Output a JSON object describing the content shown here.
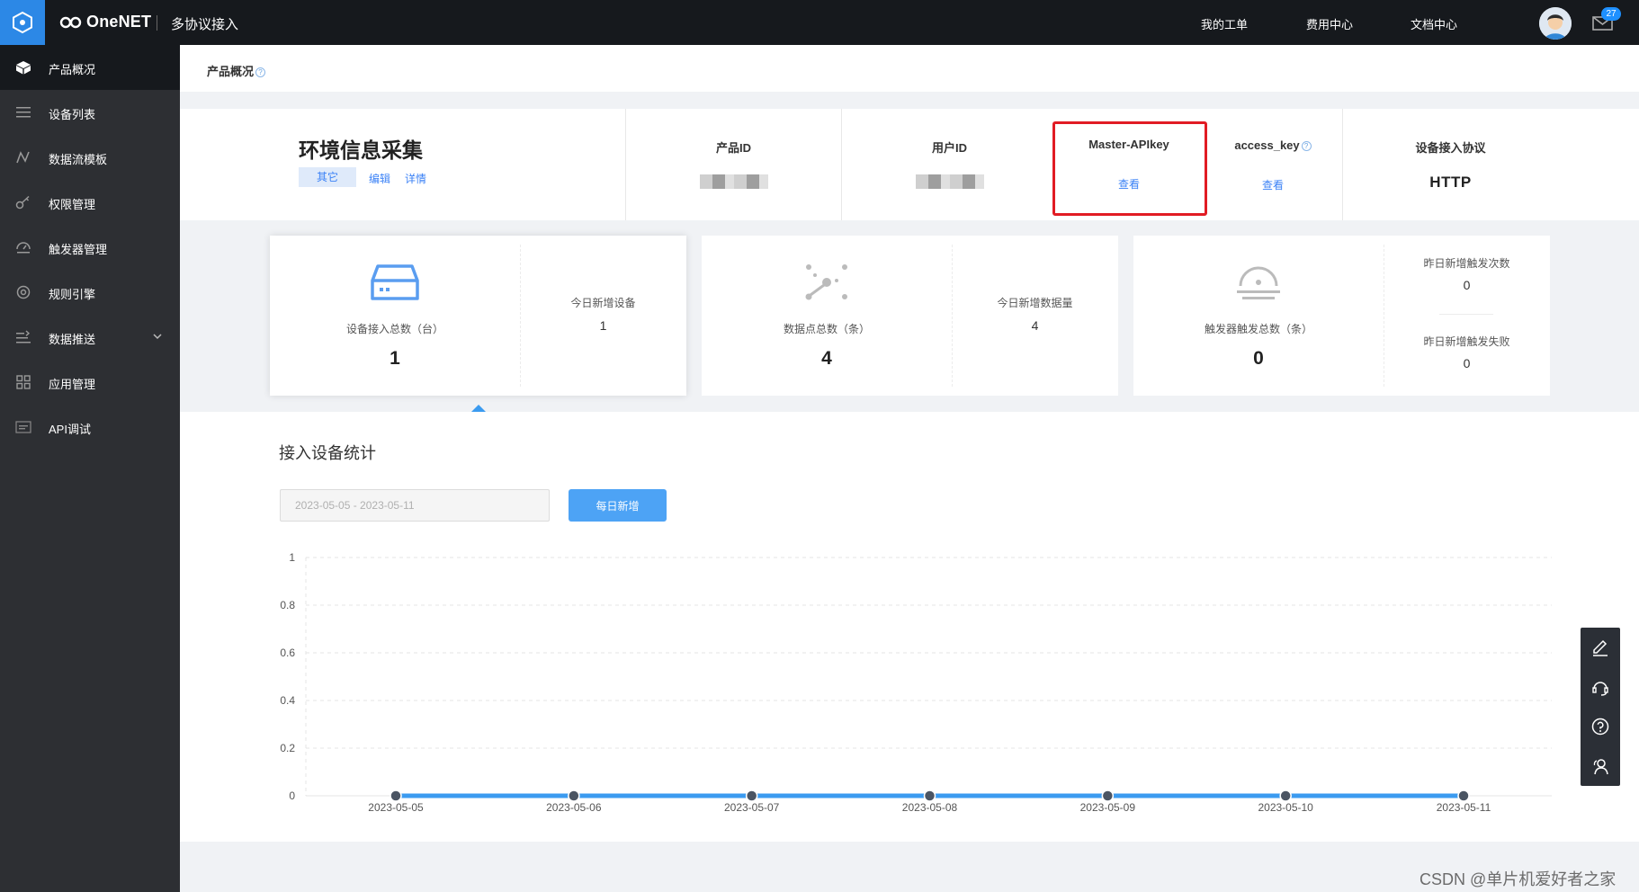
{
  "topbar": {
    "brand": "OneNET",
    "product_name": "多协议接入",
    "nav": [
      "我的工单",
      "费用中心",
      "文档中心"
    ],
    "mail_badge": "27"
  },
  "sidebar": {
    "items": [
      {
        "label": "产品概况",
        "icon": "cube-icon",
        "active": true
      },
      {
        "label": "设备列表",
        "icon": "list-icon"
      },
      {
        "label": "数据流模板",
        "icon": "datastream-icon"
      },
      {
        "label": "权限管理",
        "icon": "key-icon"
      },
      {
        "label": "触发器管理",
        "icon": "trigger-icon"
      },
      {
        "label": "规则引擎",
        "icon": "rule-engine-icon"
      },
      {
        "label": "数据推送",
        "icon": "push-icon",
        "expandable": true
      },
      {
        "label": "应用管理",
        "icon": "apps-icon"
      },
      {
        "label": "API调试",
        "icon": "api-icon"
      }
    ]
  },
  "breadcrumb": {
    "title": "产品概况",
    "help": "?"
  },
  "product": {
    "name": "环境信息采集",
    "tag": "其它",
    "edit": "编辑",
    "detail": "详情"
  },
  "info_cells": {
    "product_id_label": "产品ID",
    "user_id_label": "用户ID",
    "master_apikey_label": "Master-APIkey",
    "master_apikey_link": "查看",
    "access_key_label": "access_key",
    "access_key_link": "查看",
    "protocol_label": "设备接入协议",
    "protocol_value": "HTTP"
  },
  "stats": {
    "devices": {
      "label": "设备接入总数（台）",
      "value": "1",
      "today_label": "今日新增设备",
      "today_value": "1"
    },
    "datapoints": {
      "label": "数据点总数（条）",
      "value": "4",
      "today_label": "今日新增数据量",
      "today_value": "4"
    },
    "triggers": {
      "label": "触发器触发总数（条）",
      "value": "0",
      "yesterday_label": "昨日新增触发次数",
      "yesterday_value": "0",
      "fail_label": "昨日新增触发失败",
      "fail_value": "0"
    }
  },
  "chart_section": {
    "title": "接入设备统计",
    "date_range": "2023-05-05 - 2023-05-11",
    "daily_button": "每日新增"
  },
  "chart_data": {
    "type": "line",
    "x": [
      "2023-05-05",
      "2023-05-06",
      "2023-05-07",
      "2023-05-08",
      "2023-05-09",
      "2023-05-10",
      "2023-05-11"
    ],
    "values": [
      0,
      0,
      0,
      0,
      0,
      0,
      0
    ],
    "yticks": [
      "0",
      "0.2",
      "0.4",
      "0.6",
      "0.8",
      "1"
    ],
    "ylim": [
      0,
      1
    ],
    "grid": true,
    "color": "#3b9bf0"
  },
  "watermark": "CSDN @单片机爱好者之家",
  "colors": {
    "accent": "#2c88e6",
    "highlight": "#e11c24",
    "sidebar_bg": "#2d2f33",
    "topbar_bg": "#16191d"
  }
}
